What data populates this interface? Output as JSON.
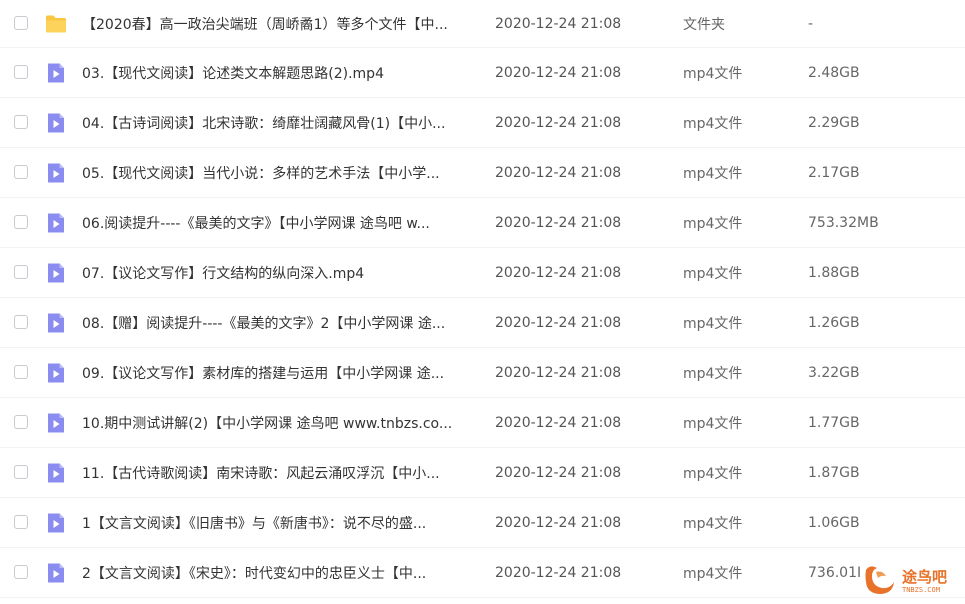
{
  "files": [
    {
      "kind": "folder",
      "name": "【2020春】高一政治尖端班（周峤矞1）等多个文件【中...",
      "date": "2020-12-24 21:08",
      "type": "文件夹",
      "size": "-"
    },
    {
      "kind": "video",
      "name": "03.【现代文阅读】论述类文本解题思路(2).mp4",
      "date": "2020-12-24 21:08",
      "type": "mp4文件",
      "size": "2.48GB"
    },
    {
      "kind": "video",
      "name": "04.【古诗词阅读】北宋诗歌：绮靡壮阔藏风骨(1)【中小...",
      "date": "2020-12-24 21:08",
      "type": "mp4文件",
      "size": "2.29GB"
    },
    {
      "kind": "video",
      "name": "05.【现代文阅读】当代小说：多样的艺术手法【中小学...",
      "date": "2020-12-24 21:08",
      "type": "mp4文件",
      "size": "2.17GB"
    },
    {
      "kind": "video",
      "name": "06.阅读提升----《最美的文字》【中小学网课 途鸟吧 w...",
      "date": "2020-12-24 21:08",
      "type": "mp4文件",
      "size": "753.32MB"
    },
    {
      "kind": "video",
      "name": "07.【议论文写作】行文结构的纵向深入.mp4",
      "date": "2020-12-24 21:08",
      "type": "mp4文件",
      "size": "1.88GB"
    },
    {
      "kind": "video",
      "name": "08.【赠】阅读提升----《最美的文字》2【中小学网课 途...",
      "date": "2020-12-24 21:08",
      "type": "mp4文件",
      "size": "1.26GB"
    },
    {
      "kind": "video",
      "name": "09.【议论文写作】素材库的搭建与运用【中小学网课 途...",
      "date": "2020-12-24 21:08",
      "type": "mp4文件",
      "size": "3.22GB"
    },
    {
      "kind": "video",
      "name": "10.期中测试讲解(2)【中小学网课 途鸟吧 www.tnbzs.co...",
      "date": "2020-12-24 21:08",
      "type": "mp4文件",
      "size": "1.77GB"
    },
    {
      "kind": "video",
      "name": "11.【古代诗歌阅读】南宋诗歌：风起云涌叹浮沉【中小...",
      "date": "2020-12-24 21:08",
      "type": "mp4文件",
      "size": "1.87GB"
    },
    {
      "kind": "video",
      "name": "1【文言文阅读】《旧唐书》与《新唐书》：说不尽的盛...",
      "date": "2020-12-24 21:08",
      "type": "mp4文件",
      "size": "1.06GB"
    },
    {
      "kind": "video",
      "name": "2【文言文阅读】《宋史》：时代变幻中的忠臣义士【中...",
      "date": "2020-12-24 21:08",
      "type": "mp4文件",
      "size": "736.01I"
    }
  ],
  "watermark": {
    "text": "途鸟吧",
    "sub": "TNBZS.COM"
  },
  "colors": {
    "folder": "#fbc641",
    "video": "#8a8cf0",
    "accent": "#e8722a"
  },
  "icons": {
    "folder": "folder-icon",
    "video": "video-file-icon",
    "checkbox": "checkbox"
  }
}
